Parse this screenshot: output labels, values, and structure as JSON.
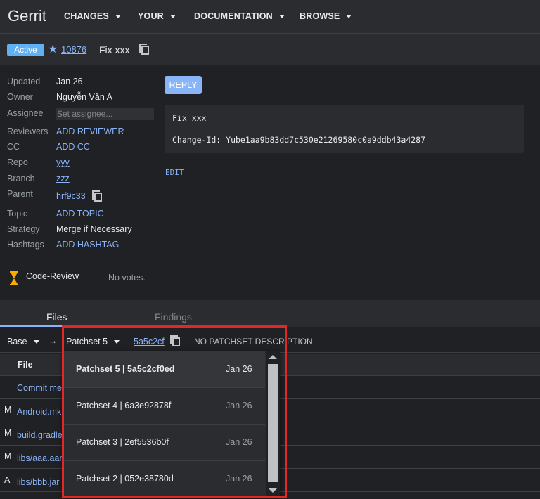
{
  "app": {
    "brand": "Gerrit"
  },
  "nav": [
    {
      "label": "CHANGES"
    },
    {
      "label": "YOUR"
    },
    {
      "label": "DOCUMENTATION"
    },
    {
      "label": "BROWSE"
    }
  ],
  "change": {
    "status": "Active",
    "number": "10876",
    "subject": "Fix xxx"
  },
  "meta": {
    "updated_label": "Updated",
    "updated": "Jan 26",
    "owner_label": "Owner",
    "owner": "Nguyễn Văn A",
    "assignee_label": "Assignee",
    "assignee_placeholder": "Set assignee...",
    "reviewers_label": "Reviewers",
    "reviewers": "ADD REVIEWER",
    "cc_label": "CC",
    "cc": "ADD CC",
    "repo_label": "Repo",
    "repo": "yyy",
    "branch_label": "Branch",
    "branch": "zzz",
    "parent_label": "Parent",
    "parent": "hrf9c33",
    "topic_label": "Topic",
    "topic": "ADD TOPIC",
    "strategy_label": "Strategy",
    "strategy": "Merge if Necessary",
    "hashtags_label": "Hashtags",
    "hashtags": "ADD HASHTAG"
  },
  "message": {
    "reply": "REPLY",
    "line1": "Fix xxx",
    "line2": "Change-Id: Yube1aa9b83dd7c530e21269580c0a9ddb43a4287",
    "edit": "EDIT"
  },
  "labels": {
    "code_review": "Code-Review",
    "no_votes": "No votes."
  },
  "tabs": {
    "files": "Files",
    "findings": "Findings"
  },
  "patchset_bar": {
    "base": "Base",
    "arrow": "→",
    "patchset": "Patchset 5",
    "hash": "5a5c2cf",
    "description": "NO PATCHSET DESCRIPTION"
  },
  "files": {
    "header": "File",
    "rows": [
      {
        "status": "",
        "name": "Commit message"
      },
      {
        "status": "M",
        "name": "Android.mk"
      },
      {
        "status": "M",
        "name": "build.gradle"
      },
      {
        "status": "M",
        "name": "libs/aaa.aar"
      },
      {
        "status": "A",
        "name": "libs/bbb.jar"
      }
    ]
  },
  "patchset_dropdown": [
    {
      "label": "Patchset 5 | 5a5c2cf0ed",
      "date": "Jan 26"
    },
    {
      "label": "Patchset 4 | 6a3e92878f",
      "date": "Jan 26"
    },
    {
      "label": "Patchset 3 | 2ef5536b0f",
      "date": "Jan 26"
    },
    {
      "label": "Patchset 2 | 052e38780d",
      "date": "Jan 26"
    }
  ],
  "colors": {
    "accent": "#8ab4f8",
    "status_active": "#5fb0f5",
    "highlight": "#e32626",
    "hourglass": "#f9ab00"
  }
}
